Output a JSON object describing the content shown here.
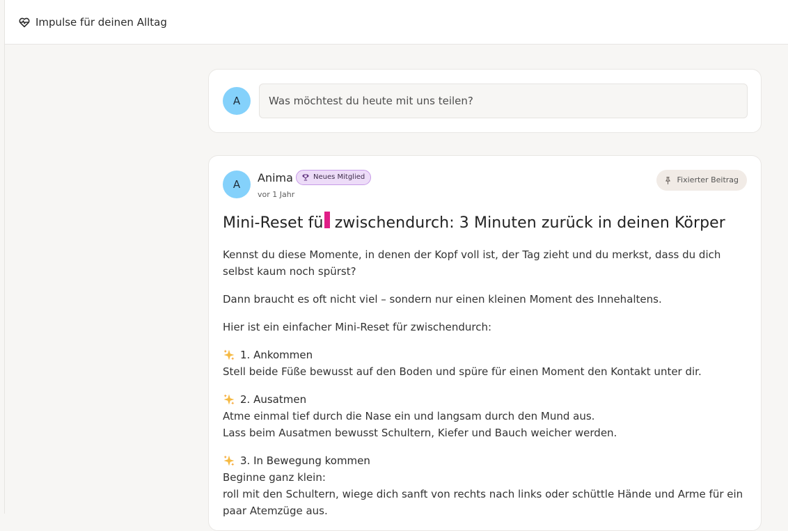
{
  "topbar": {
    "title": "Impulse für deinen Alltag"
  },
  "composer": {
    "avatar_initial": "A",
    "placeholder": "Was möchtest du heute mit uns teilen?"
  },
  "post": {
    "author": "Anima",
    "badge": "Neues Mitglied",
    "time": "vor 1 Jahr",
    "pinned": "Fixierter Beitrag",
    "avatar_initial": "A",
    "title": "Mini-Reset für zwischendurch: 3 Minuten zurück in deinen Körper",
    "intro": [
      "Kennst du diese Momente, in denen der Kopf voll ist, der Tag zieht und du merkst, dass du dich selbst kaum noch spürst?",
      "Dann braucht es oft nicht viel – sondern nur einen kleinen Moment des Innehaltens.",
      "Hier ist ein einfacher Mini-Reset für zwischendurch:"
    ],
    "steps": [
      {
        "heading": "1. Ankommen",
        "lines": [
          "Stell beide Füße bewusst auf den Boden und spüre für einen Moment den Kontakt unter dir."
        ]
      },
      {
        "heading": "2. Ausatmen",
        "lines": [
          "Atme einmal tief durch die Nase ein und langsam durch den Mund aus.",
          "Lass beim Ausatmen bewusst Schultern, Kiefer und Bauch weicher werden."
        ]
      },
      {
        "heading": "3. In Bewegung kommen",
        "lines": [
          "Beginne ganz klein:",
          "roll mit den Schultern, wiege dich sanft von rechts nach links oder schüttle Hände und Arme für ein paar Atemzüge aus."
        ]
      }
    ]
  },
  "icons": {
    "topbar": "heart-pulse-icon",
    "badge": "trophy-icon",
    "pinned": "pin-icon",
    "step": "sparkles-icon"
  },
  "colors": {
    "avatar": "#84d1fb",
    "badge_bg": "#eddcf8",
    "badge_border": "#c79be7",
    "pinned_bg": "#f1ebe6",
    "cursor": "#e01e87",
    "sparkle": "#f5b942"
  }
}
